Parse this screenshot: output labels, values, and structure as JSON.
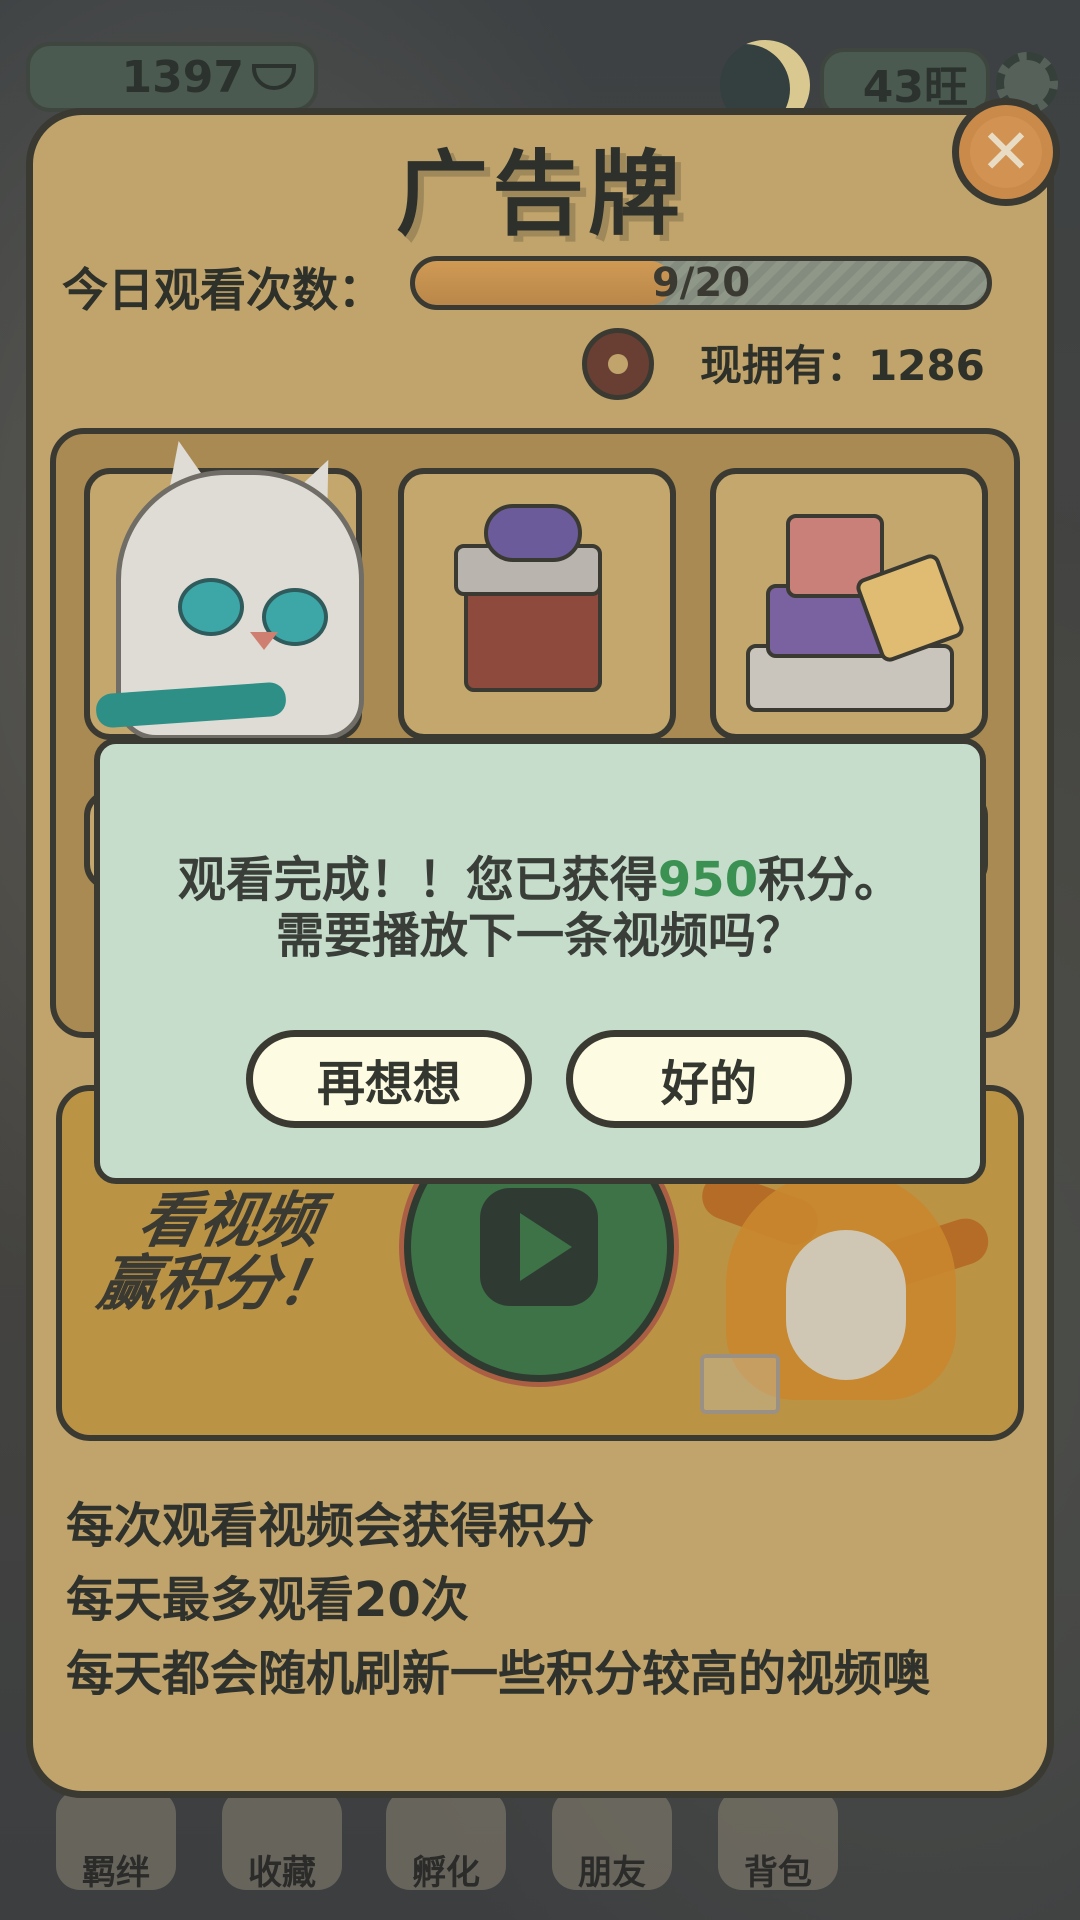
{
  "hud": {
    "coins": "1397",
    "wang": "43旺"
  },
  "panel": {
    "title": "广告牌",
    "watch_label": "今日观看次数：",
    "progress_text": "9/20",
    "progress_fraction": 0.45,
    "owned_text": "现拥有：1286"
  },
  "play": {
    "slogan_1": "看视频",
    "slogan_2": "赢积分！"
  },
  "info": [
    "每次观看视频会获得积分",
    "每天最多观看20次",
    "每天都会随机刷新一些积分较高的视频噢"
  ],
  "dialog": {
    "line1_prefix": "观看完成！！您已获得",
    "line1_points": "950",
    "line1_suffix": "积分。",
    "line2": "需要播放下一条视频吗？",
    "cancel_label": "再想想",
    "ok_label": "好的"
  },
  "bottom_nav": [
    {
      "label": "羁绊"
    },
    {
      "label": "收藏"
    },
    {
      "label": "孵化"
    },
    {
      "label": "朋友"
    },
    {
      "label": "背包"
    }
  ],
  "colors": {
    "panel_bg": "#c0a46b",
    "dialog_bg": "#c6ddcc",
    "points_highlight": "#3b9152",
    "play_button": "#3d7346"
  },
  "icons": [
    "ingot-icon",
    "moon-icon",
    "settings-gear-icon",
    "close-icon",
    "donut-icon",
    "play-icon"
  ]
}
